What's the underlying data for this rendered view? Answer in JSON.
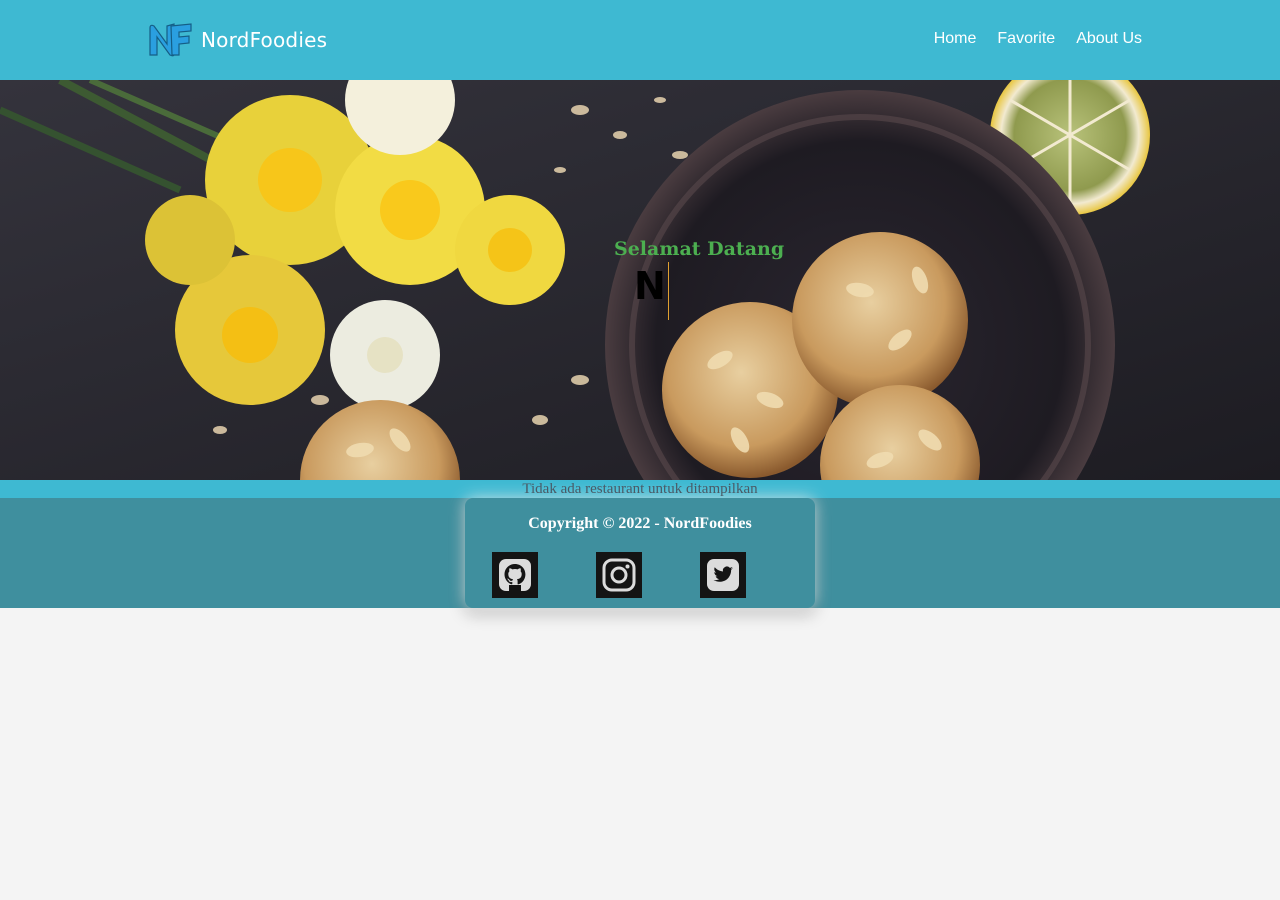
{
  "header": {
    "logo_text": "NordFoodies",
    "nav": [
      {
        "label": "Home"
      },
      {
        "label": "Favorite"
      },
      {
        "label": "About Us"
      }
    ]
  },
  "hero": {
    "greeting": "Selamat Datang",
    "typed_text": "N"
  },
  "main": {
    "empty_message": "Tidak ada restaurant untuk ditampilkan"
  },
  "footer": {
    "copyright_prefix": "Copyright © 2022 - ",
    "copyright_brand": "NordFoodies",
    "socials": [
      {
        "icon": "github-icon"
      },
      {
        "icon": "instagram-icon"
      },
      {
        "icon": "twitter-icon"
      }
    ]
  },
  "colors": {
    "navbar": "#3eb9d2",
    "footer": "#3f8f9e",
    "greeting": "#4caf50",
    "page_background": "#f4f4f4"
  }
}
